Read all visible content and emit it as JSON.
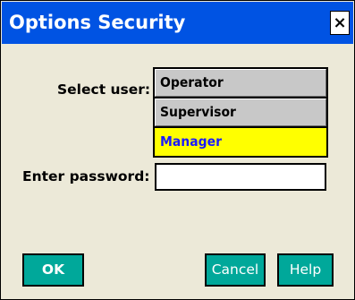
{
  "window": {
    "title": "Options Security",
    "close_glyph": "×"
  },
  "form": {
    "select_user_label": "Select user:",
    "password_label": "Enter password:",
    "password_value": ""
  },
  "users": [
    {
      "label": "Operator",
      "selected": false
    },
    {
      "label": "Supervisor",
      "selected": false
    },
    {
      "label": "Manager",
      "selected": true
    }
  ],
  "buttons": {
    "ok_label": "OK",
    "cancel_label": "Cancel",
    "help_label": "Help"
  },
  "colors": {
    "titlebar": "#0053e3",
    "dialog_background": "#ece9d8",
    "button": "#00a89a",
    "selected_item_background": "#ffff00",
    "selected_item_text": "#1a1aff",
    "list_item_background": "#c8c8c8"
  }
}
